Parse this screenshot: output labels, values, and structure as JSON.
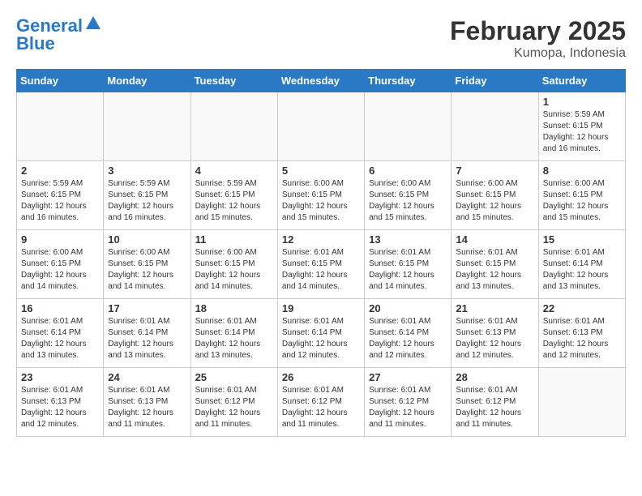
{
  "header": {
    "logo_line1": "General",
    "logo_line2": "Blue",
    "month_title": "February 2025",
    "location": "Kumopa, Indonesia"
  },
  "days_of_week": [
    "Sunday",
    "Monday",
    "Tuesday",
    "Wednesday",
    "Thursday",
    "Friday",
    "Saturday"
  ],
  "weeks": [
    [
      {
        "day": "",
        "info": ""
      },
      {
        "day": "",
        "info": ""
      },
      {
        "day": "",
        "info": ""
      },
      {
        "day": "",
        "info": ""
      },
      {
        "day": "",
        "info": ""
      },
      {
        "day": "",
        "info": ""
      },
      {
        "day": "1",
        "info": "Sunrise: 5:59 AM\nSunset: 6:15 PM\nDaylight: 12 hours\nand 16 minutes."
      }
    ],
    [
      {
        "day": "2",
        "info": "Sunrise: 5:59 AM\nSunset: 6:15 PM\nDaylight: 12 hours\nand 16 minutes."
      },
      {
        "day": "3",
        "info": "Sunrise: 5:59 AM\nSunset: 6:15 PM\nDaylight: 12 hours\nand 16 minutes."
      },
      {
        "day": "4",
        "info": "Sunrise: 5:59 AM\nSunset: 6:15 PM\nDaylight: 12 hours\nand 15 minutes."
      },
      {
        "day": "5",
        "info": "Sunrise: 6:00 AM\nSunset: 6:15 PM\nDaylight: 12 hours\nand 15 minutes."
      },
      {
        "day": "6",
        "info": "Sunrise: 6:00 AM\nSunset: 6:15 PM\nDaylight: 12 hours\nand 15 minutes."
      },
      {
        "day": "7",
        "info": "Sunrise: 6:00 AM\nSunset: 6:15 PM\nDaylight: 12 hours\nand 15 minutes."
      },
      {
        "day": "8",
        "info": "Sunrise: 6:00 AM\nSunset: 6:15 PM\nDaylight: 12 hours\nand 15 minutes."
      }
    ],
    [
      {
        "day": "9",
        "info": "Sunrise: 6:00 AM\nSunset: 6:15 PM\nDaylight: 12 hours\nand 14 minutes."
      },
      {
        "day": "10",
        "info": "Sunrise: 6:00 AM\nSunset: 6:15 PM\nDaylight: 12 hours\nand 14 minutes."
      },
      {
        "day": "11",
        "info": "Sunrise: 6:00 AM\nSunset: 6:15 PM\nDaylight: 12 hours\nand 14 minutes."
      },
      {
        "day": "12",
        "info": "Sunrise: 6:01 AM\nSunset: 6:15 PM\nDaylight: 12 hours\nand 14 minutes."
      },
      {
        "day": "13",
        "info": "Sunrise: 6:01 AM\nSunset: 6:15 PM\nDaylight: 12 hours\nand 14 minutes."
      },
      {
        "day": "14",
        "info": "Sunrise: 6:01 AM\nSunset: 6:15 PM\nDaylight: 12 hours\nand 13 minutes."
      },
      {
        "day": "15",
        "info": "Sunrise: 6:01 AM\nSunset: 6:14 PM\nDaylight: 12 hours\nand 13 minutes."
      }
    ],
    [
      {
        "day": "16",
        "info": "Sunrise: 6:01 AM\nSunset: 6:14 PM\nDaylight: 12 hours\nand 13 minutes."
      },
      {
        "day": "17",
        "info": "Sunrise: 6:01 AM\nSunset: 6:14 PM\nDaylight: 12 hours\nand 13 minutes."
      },
      {
        "day": "18",
        "info": "Sunrise: 6:01 AM\nSunset: 6:14 PM\nDaylight: 12 hours\nand 13 minutes."
      },
      {
        "day": "19",
        "info": "Sunrise: 6:01 AM\nSunset: 6:14 PM\nDaylight: 12 hours\nand 12 minutes."
      },
      {
        "day": "20",
        "info": "Sunrise: 6:01 AM\nSunset: 6:14 PM\nDaylight: 12 hours\nand 12 minutes."
      },
      {
        "day": "21",
        "info": "Sunrise: 6:01 AM\nSunset: 6:13 PM\nDaylight: 12 hours\nand 12 minutes."
      },
      {
        "day": "22",
        "info": "Sunrise: 6:01 AM\nSunset: 6:13 PM\nDaylight: 12 hours\nand 12 minutes."
      }
    ],
    [
      {
        "day": "23",
        "info": "Sunrise: 6:01 AM\nSunset: 6:13 PM\nDaylight: 12 hours\nand 12 minutes."
      },
      {
        "day": "24",
        "info": "Sunrise: 6:01 AM\nSunset: 6:13 PM\nDaylight: 12 hours\nand 11 minutes."
      },
      {
        "day": "25",
        "info": "Sunrise: 6:01 AM\nSunset: 6:12 PM\nDaylight: 12 hours\nand 11 minutes."
      },
      {
        "day": "26",
        "info": "Sunrise: 6:01 AM\nSunset: 6:12 PM\nDaylight: 12 hours\nand 11 minutes."
      },
      {
        "day": "27",
        "info": "Sunrise: 6:01 AM\nSunset: 6:12 PM\nDaylight: 12 hours\nand 11 minutes."
      },
      {
        "day": "28",
        "info": "Sunrise: 6:01 AM\nSunset: 6:12 PM\nDaylight: 12 hours\nand 11 minutes."
      },
      {
        "day": "",
        "info": ""
      }
    ]
  ]
}
